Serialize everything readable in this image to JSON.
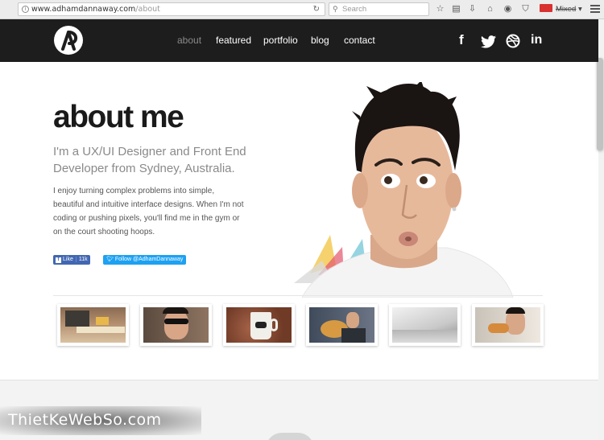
{
  "browser": {
    "url_host": "www.adhamdannaway.com",
    "url_path": "/about",
    "search_placeholder": "Search",
    "mixed_label": "Mixed"
  },
  "header": {
    "nav": [
      {
        "label": "about",
        "active": true
      },
      {
        "label": "featured",
        "active": false
      },
      {
        "label": "portfolio",
        "active": false
      },
      {
        "label": "blog",
        "active": false
      },
      {
        "label": "contact",
        "active": false
      }
    ],
    "social": [
      "f",
      "twitter",
      "dribbble",
      "in"
    ]
  },
  "hero": {
    "title": "about me",
    "subtitle": "I'm a UX/UI Designer and Front End Developer from Sydney, Australia.",
    "body": "I enjoy turning complex problems into simple, beautiful and intuitive interface designs. When I'm not coding or pushing pixels, you'll find me in the gym or on the court shooting hoops.",
    "like_label": "Like",
    "like_count": "11k",
    "follow_label": "Follow @AdhamDannaway"
  },
  "thumbnails": [
    {
      "name": "desk-thumb"
    },
    {
      "name": "sunglasses-thumb"
    },
    {
      "name": "mug-thumb"
    },
    {
      "name": "guitar-thumb"
    },
    {
      "name": "laptop-thumb"
    },
    {
      "name": "eating-thumb"
    }
  ],
  "watermark": "ThietKeWebSo.com"
}
